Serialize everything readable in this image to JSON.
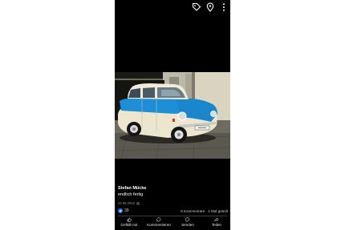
{
  "post": {
    "author": "Stefan Mücke",
    "caption": "endlich fertig",
    "date": "24.06.2012",
    "reaction_count": "39",
    "comments": "9 Kommentare",
    "shares": "1 Mal geteilt"
  },
  "actions": {
    "like": "Gefällt mir",
    "comment": "Kommentieren",
    "send": "Senden",
    "share": "Teilen"
  },
  "icons": [
    "tag-icon",
    "location-pin-icon",
    "more-options-icon",
    "globe-icon",
    "thumbs-up-icon",
    "comment-icon",
    "messenger-icon",
    "share-icon"
  ],
  "colors": {
    "accent": "#1877f2",
    "background": "#000000",
    "car_blue": "#1e8fd6",
    "car_cream": "#ede6cf"
  }
}
